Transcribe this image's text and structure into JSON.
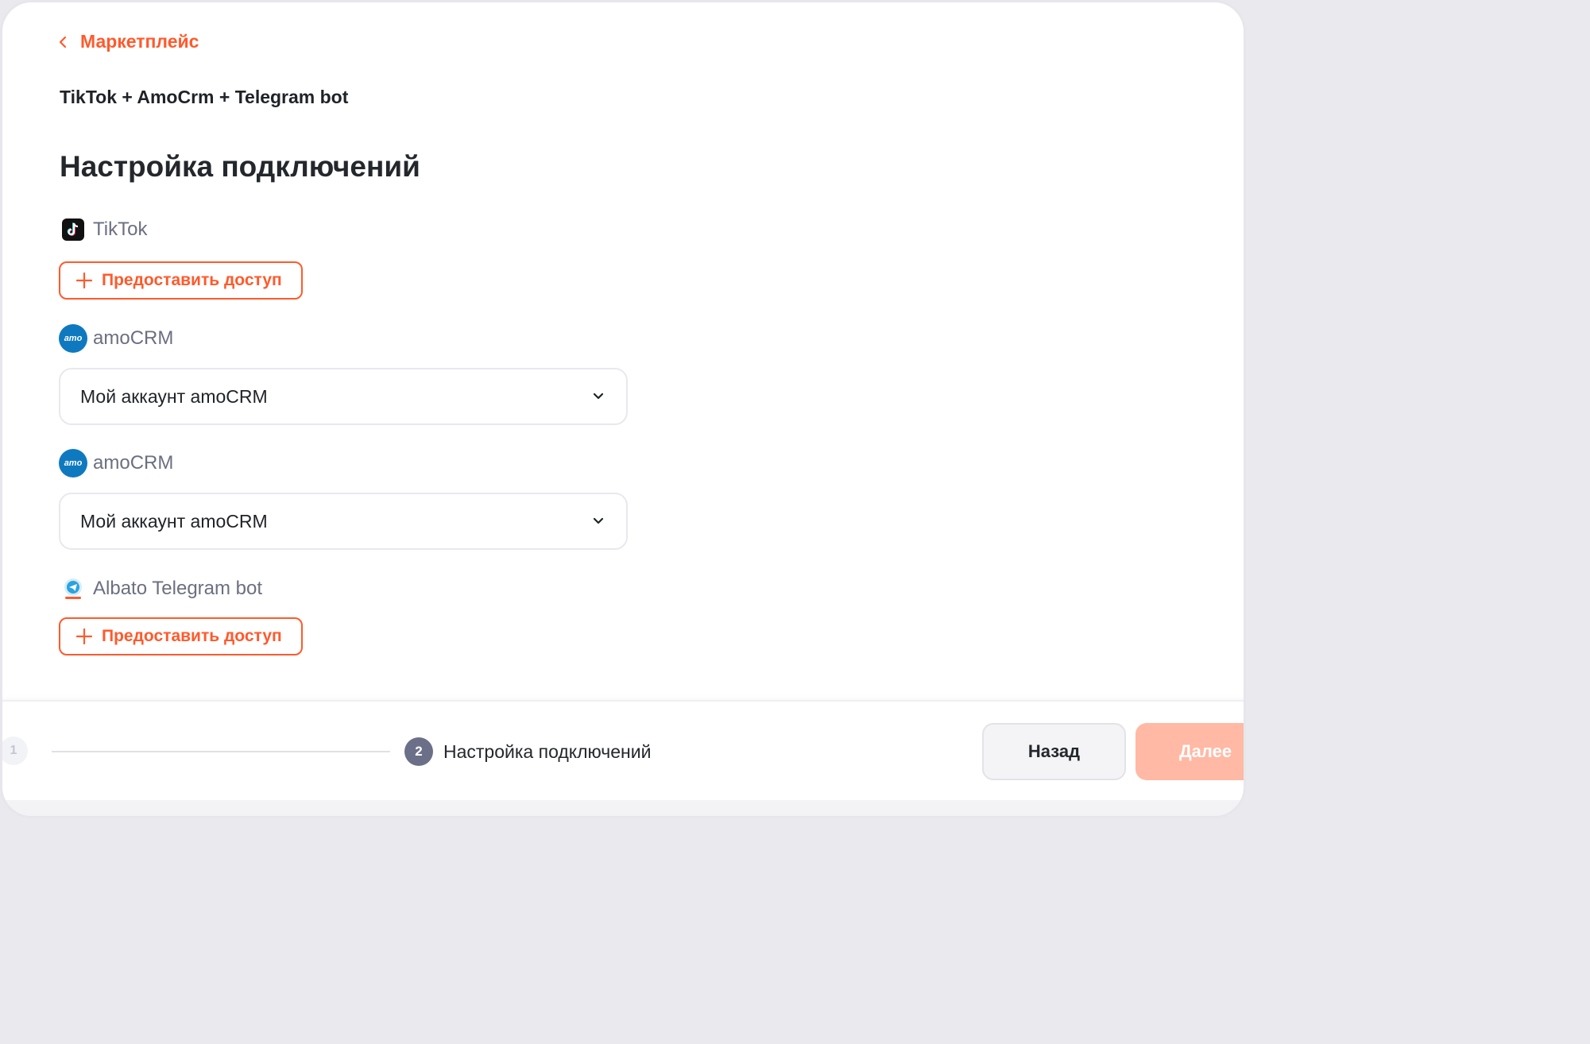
{
  "nav": {
    "back_label": "Маркетплейс"
  },
  "header": {
    "subtitle": "TikTok + AmoCrm + Telegram bot",
    "title": "Настройка подключений"
  },
  "connections": [
    {
      "service": "TikTok",
      "icon": "tiktok-icon",
      "action_label": "Предоставить доступ"
    },
    {
      "service": "amoCRM",
      "icon": "amocrm-icon",
      "logo_text": "amo",
      "selected_account": "Мой аккаунт amoCRM"
    },
    {
      "service": "amoCRM",
      "icon": "amocrm-icon",
      "logo_text": "amo",
      "selected_account": "Мой аккаунт amoCRM"
    },
    {
      "service": "Albato Telegram bot",
      "icon": "telegram-bot-icon",
      "action_label": "Предоставить доступ"
    }
  ],
  "footer": {
    "steps": [
      {
        "number": "1",
        "state": "inactive"
      },
      {
        "number": "2",
        "label": "Настройка подключений",
        "state": "active"
      }
    ],
    "back_button": "Назад",
    "next_button": "Далее"
  },
  "colors": {
    "accent": "#ff5a2c",
    "accent_disabled": "#ffb9a4",
    "muted_text": "#6b6f80",
    "amocrm_blue": "#0f79c0",
    "step_active": "#6b7088"
  }
}
